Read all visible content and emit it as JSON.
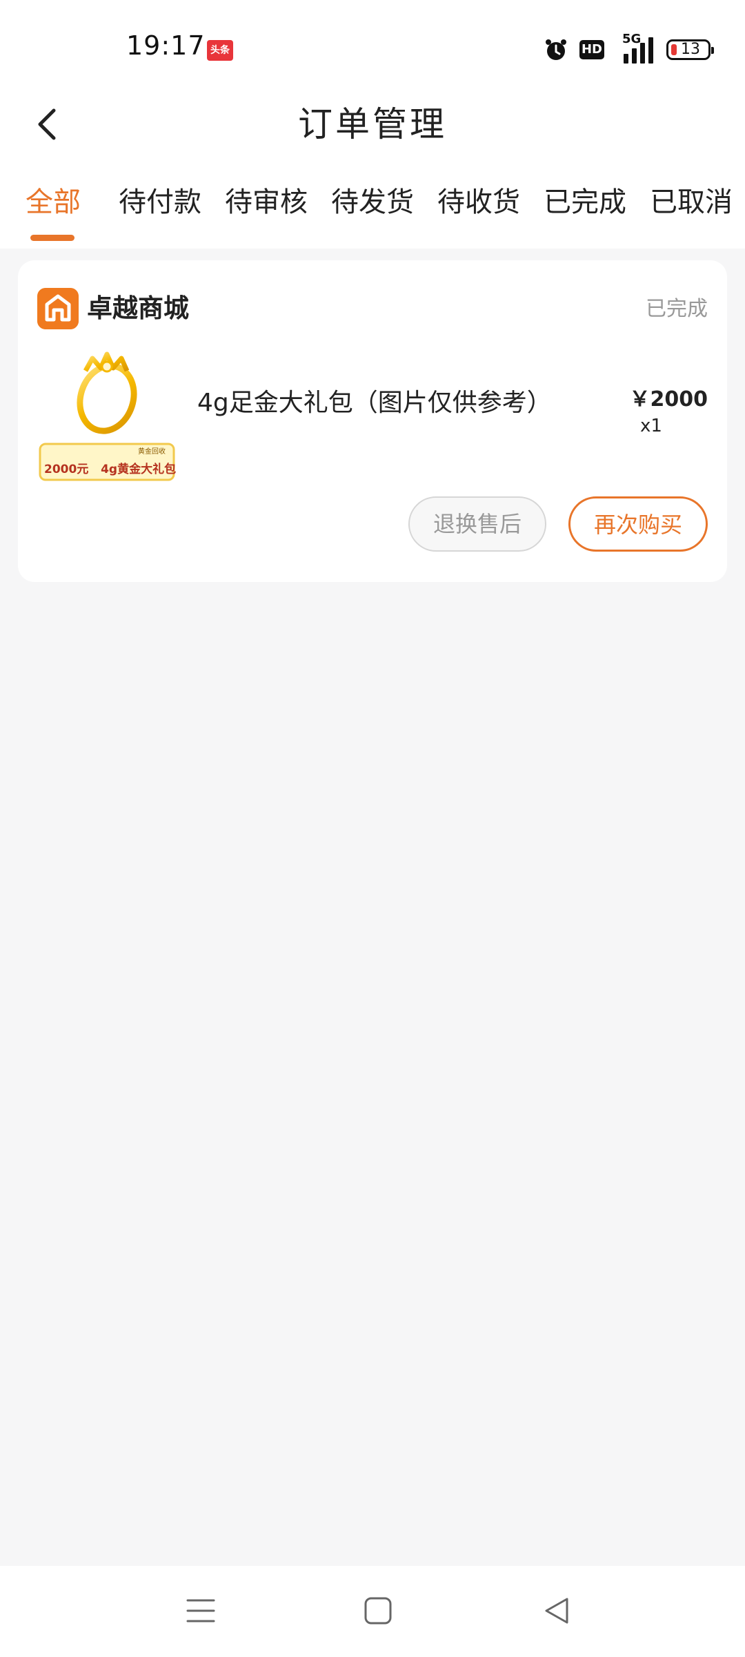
{
  "status_bar": {
    "time": "19:17",
    "news_badge": "头条",
    "hd_label": "HD",
    "network": "5G",
    "battery": "13"
  },
  "header": {
    "title": "订单管理"
  },
  "tabs": [
    {
      "label": "全部",
      "active": true
    },
    {
      "label": "待付款"
    },
    {
      "label": "待审核"
    },
    {
      "label": "待发货"
    },
    {
      "label": "待收货"
    },
    {
      "label": "已完成"
    },
    {
      "label": "已取消"
    }
  ],
  "order": {
    "shop_name": "卓越商城",
    "status": "已完成",
    "product_name": "4g足金大礼包（图片仅供参考）",
    "price": "￥2000",
    "quantity": "x1",
    "thumb_tag": "黄金回收",
    "thumb_caption": "2000元   4g黄金大礼包",
    "buttons": {
      "return": "退换售后",
      "rebuy": "再次购买"
    }
  },
  "colors": {
    "accent": "#e8752a",
    "background": "#f6f6f7",
    "card": "#ffffff",
    "muted": "#999999"
  }
}
